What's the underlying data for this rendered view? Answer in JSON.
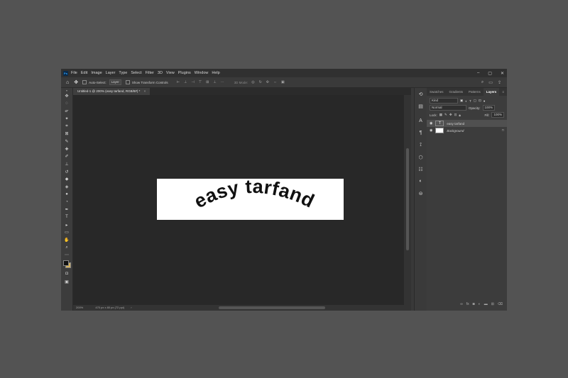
{
  "menubar": {
    "logo": "Ps",
    "items": [
      "File",
      "Edit",
      "Image",
      "Layer",
      "Type",
      "Select",
      "Filter",
      "3D",
      "View",
      "Plugins",
      "Window",
      "Help"
    ],
    "window_controls": [
      "–",
      "▢",
      "✕"
    ]
  },
  "options_bar": {
    "auto_select_label": "Auto-Select:",
    "auto_select_value": "Layer",
    "show_transform_label": "Show Transform Controls",
    "mode_3d_label": "3D Mode:"
  },
  "document": {
    "tab_title": "Untitled-1 @ 200% (easy tarfand, RGB/8#) *",
    "tab_close": "×",
    "canvas_text": "easy tarfand",
    "status_zoom": "200%",
    "status_size": "470 px x 80 px (72 ppi)"
  },
  "layers_panel": {
    "tabs": [
      "Swatches",
      "Gradients",
      "Patterns",
      "Layers"
    ],
    "active_tab": "Layers",
    "filter_label": "Kind",
    "blend_mode": "Normal",
    "opacity_label": "Opacity:",
    "opacity_value": "100%",
    "lock_label": "Lock:",
    "fill_label": "Fill:",
    "fill_value": "100%",
    "layers": [
      {
        "name": "easy tarfand",
        "type": "text",
        "selected": true
      },
      {
        "name": "Background",
        "type": "pixel",
        "selected": false
      }
    ]
  },
  "colors": {
    "foreground": "#111111",
    "background_swatch": "#d6b25c",
    "canvas": "#ffffff"
  }
}
